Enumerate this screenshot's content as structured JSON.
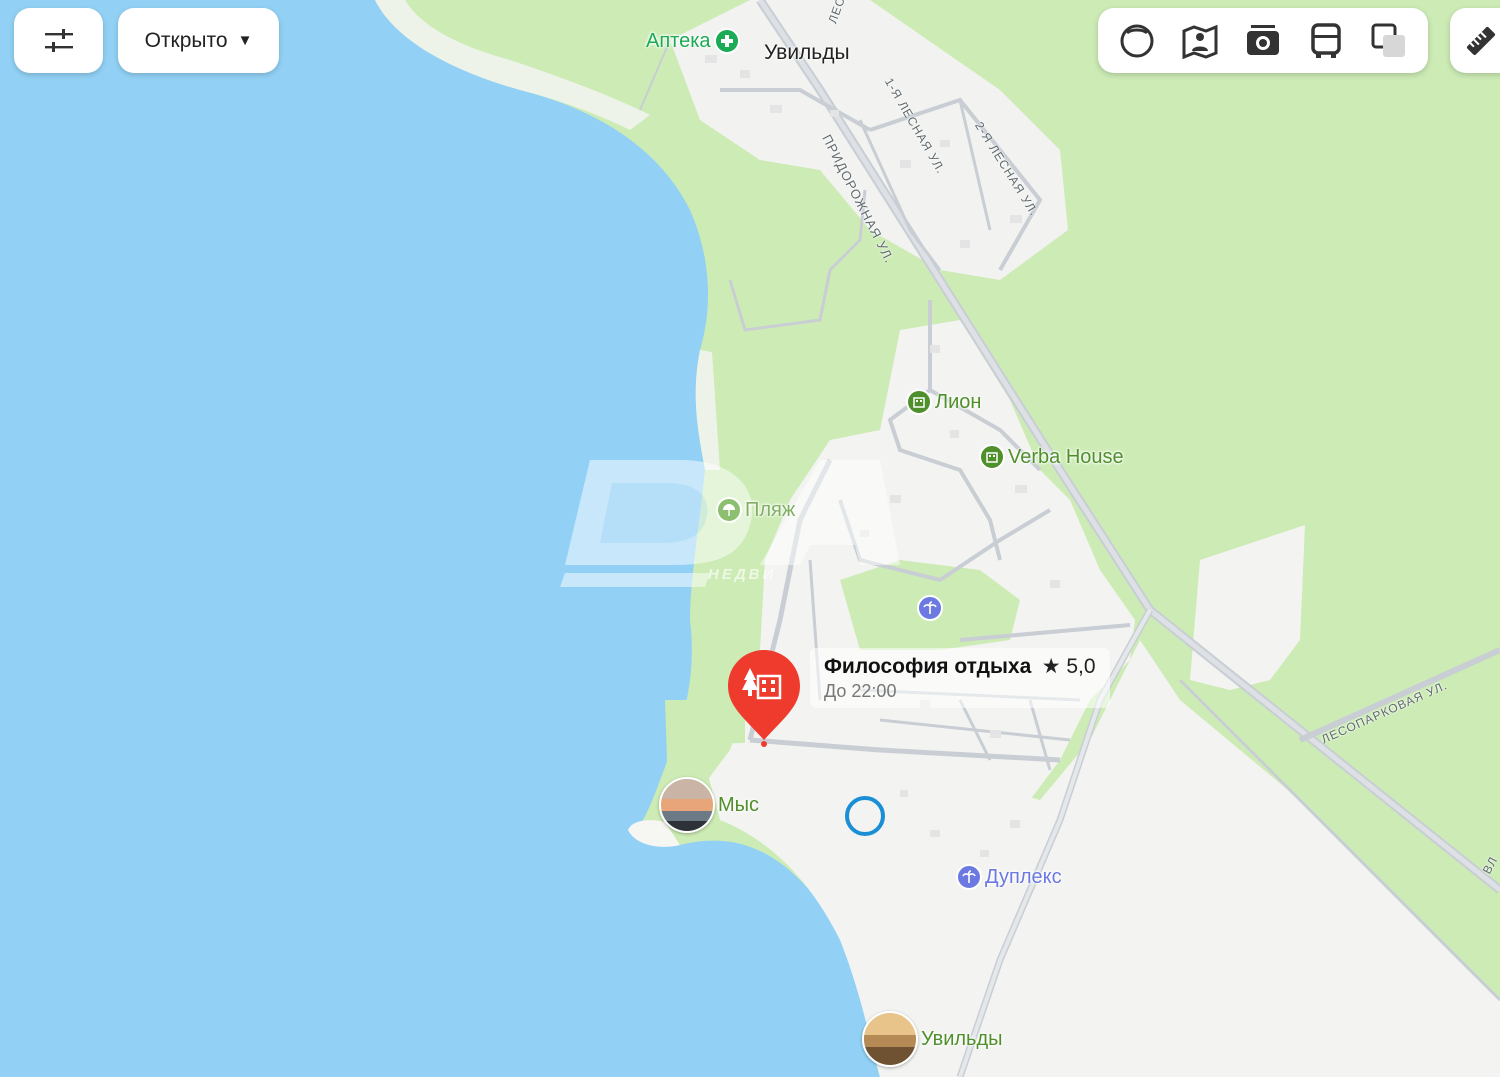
{
  "toolbar": {
    "filters_icon": "sliders-icon",
    "open_filter_label": "Открыто",
    "open_filter_caret": "▼",
    "layers": [
      {
        "name": "panorama-icon"
      },
      {
        "name": "map-book-icon"
      },
      {
        "name": "camera-icon"
      },
      {
        "name": "bus-icon"
      },
      {
        "name": "layers-icon"
      }
    ],
    "ruler_icon": "ruler-icon"
  },
  "colors": {
    "water": "#92d1f5",
    "forest": "#cdebb5",
    "settlement": "#f4f4f2",
    "road": "#c8ced4",
    "poi_green": "#4f8f2c",
    "poi_purple": "#6b79e0",
    "pharmacy": "#1aab54",
    "pin_red": "#ef3b2d",
    "location_blue": "#1a8fd6"
  },
  "places": {
    "village_north": "Увильды",
    "pharmacy": "Аптека",
    "lion": "Лион",
    "verba": "Verba House",
    "beach": "Пляж",
    "cape": "Мыс",
    "duplex": "Дуплекс",
    "village_south": "Увильды"
  },
  "streets": {
    "pridorozhnaya": "Придорожная ул.",
    "lesnaya_1": "1-я Лесная ул.",
    "lesnaya_2": "2-я Лесная ул.",
    "lesoparkovaya": "Лесопарковая ул.",
    "top_cut": "Лес",
    "right_cut": "Вл"
  },
  "selected_place": {
    "title": "Философия отдыха",
    "rating": "★ 5,0",
    "hours": "До 22:00"
  },
  "watermark": {
    "logo": "DA",
    "sub": "НЕДВИ"
  }
}
